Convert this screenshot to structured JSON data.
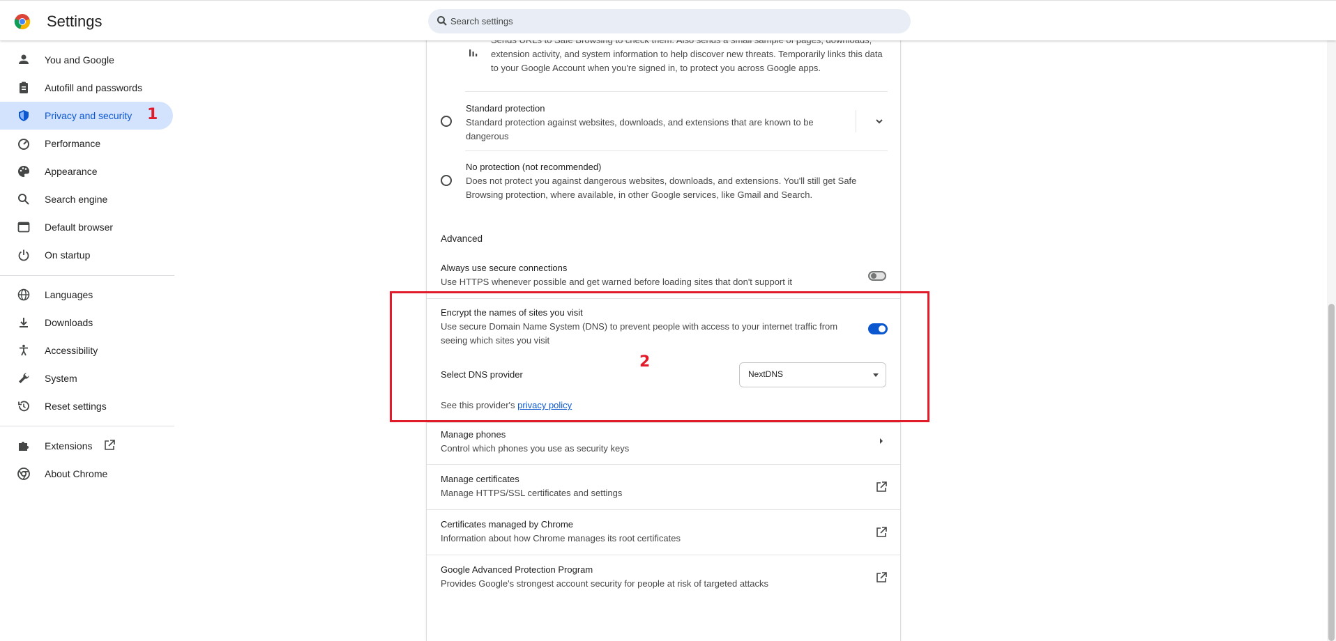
{
  "header": {
    "title": "Settings",
    "search_placeholder": "Search settings"
  },
  "sidebar": {
    "items": [
      {
        "label": "You and Google",
        "icon": "person-icon"
      },
      {
        "label": "Autofill and passwords",
        "icon": "clipboard-icon"
      },
      {
        "label": "Privacy and security",
        "icon": "shield-icon",
        "active": true
      },
      {
        "label": "Performance",
        "icon": "speedometer-icon"
      },
      {
        "label": "Appearance",
        "icon": "palette-icon"
      },
      {
        "label": "Search engine",
        "icon": "search-icon"
      },
      {
        "label": "Default browser",
        "icon": "browser-window-icon"
      },
      {
        "label": "On startup",
        "icon": "power-icon"
      },
      {
        "label": "Languages",
        "icon": "globe-icon"
      },
      {
        "label": "Downloads",
        "icon": "download-icon"
      },
      {
        "label": "Accessibility",
        "icon": "accessibility-icon"
      },
      {
        "label": "System",
        "icon": "wrench-icon"
      },
      {
        "label": "Reset settings",
        "icon": "history-icon"
      },
      {
        "label": "Extensions",
        "icon": "puzzle-icon"
      },
      {
        "label": "About Chrome",
        "icon": "chrome-icon"
      }
    ]
  },
  "annotations": {
    "one": "1",
    "two": "2"
  },
  "main": {
    "enhanced_desc_lines": [
      "Sends URLs to Safe Browsing to check them. Also sends a small sample of pages, downloads,",
      "extension activity, and system information to help discover new threats. Temporarily links this data",
      "to your Google Account when you're signed in, to protect you across Google apps."
    ],
    "standard": {
      "title": "Standard protection",
      "desc_lines": [
        "Standard protection against websites, downloads, and extensions that are known to be",
        "dangerous"
      ]
    },
    "no_protection": {
      "title": "No protection (not recommended)",
      "desc_lines": [
        "Does not protect you against dangerous websites, downloads, and extensions. You'll still get Safe",
        "Browsing protection, where available, in other Google services, like Gmail and Search."
      ]
    },
    "advanced_heading": "Advanced",
    "https": {
      "title": "Always use secure connections",
      "desc": "Use HTTPS whenever possible and get warned before loading sites that don't support it",
      "enabled": false
    },
    "dns": {
      "title": "Encrypt the names of sites you visit",
      "desc_lines": [
        "Use secure Domain Name System (DNS) to prevent people with access to your internet traffic from",
        "seeing which sites you visit"
      ],
      "enabled": true,
      "provider_label": "Select DNS provider",
      "provider_value": "NextDNS",
      "policy_prefix": "See this provider's ",
      "policy_link": "privacy policy"
    },
    "rows": [
      {
        "title": "Manage phones",
        "desc": "Control which phones you use as security keys",
        "icon": "arrow-right-icon"
      },
      {
        "title": "Manage certificates",
        "desc": "Manage HTTPS/SSL certificates and settings",
        "icon": "open-external-icon"
      },
      {
        "title": "Certificates managed by Chrome",
        "desc": "Information about how Chrome manages its root certificates",
        "icon": "open-external-icon"
      },
      {
        "title": "Google Advanced Protection Program",
        "desc": "Provides Google's strongest account security for people at risk of targeted attacks",
        "icon": "open-external-icon"
      }
    ]
  },
  "colors": {
    "accent": "#0b57d0",
    "active_nav_bg": "#d3e3fd",
    "annotation_red": "#e21b2b"
  }
}
